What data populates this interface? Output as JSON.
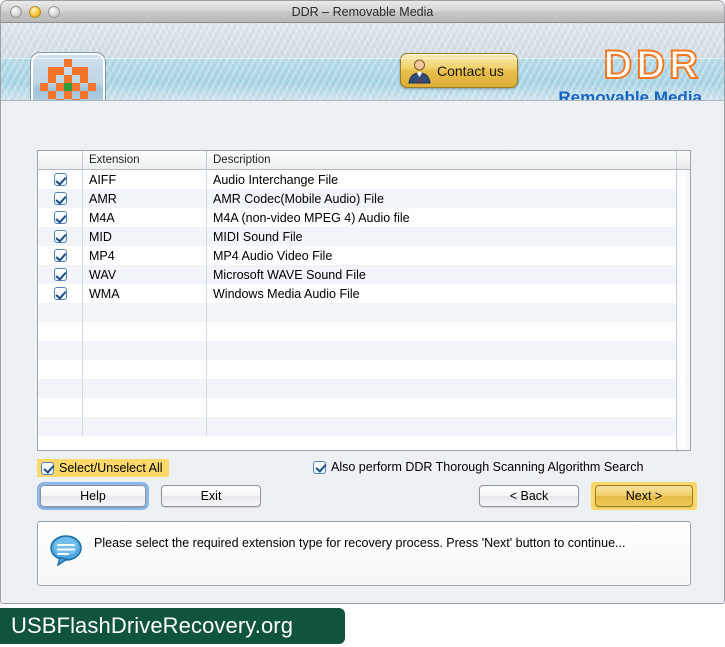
{
  "window": {
    "title": "DDR – Removable Media",
    "traffic_lights": [
      "close-button",
      "minimize-button",
      "zoom-button"
    ]
  },
  "banner": {
    "app_icon": "checkered-star-icon",
    "contact_button": {
      "label": "Contact us",
      "icon": "person-icon"
    },
    "brand": {
      "name": "DDR",
      "subtitle": "Removable Media"
    },
    "colors": {
      "brand_orange": "#f47722",
      "brand_blue": "#1765c0"
    }
  },
  "table": {
    "headers": [
      "",
      "Extension",
      "Description"
    ],
    "rows": [
      {
        "checked": true,
        "extension": "AIFF",
        "description": "Audio Interchange File"
      },
      {
        "checked": true,
        "extension": "AMR",
        "description": "AMR Codec(Mobile Audio) File"
      },
      {
        "checked": true,
        "extension": "M4A",
        "description": "M4A (non-video MPEG 4) Audio file"
      },
      {
        "checked": true,
        "extension": "MID",
        "description": "MIDI Sound File"
      },
      {
        "checked": true,
        "extension": "MP4",
        "description": "MP4 Audio Video File"
      },
      {
        "checked": true,
        "extension": "WAV",
        "description": "Microsoft WAVE Sound File"
      },
      {
        "checked": true,
        "extension": "WMA",
        "description": "Windows Media Audio File"
      }
    ],
    "empty_row_count": 7
  },
  "options": {
    "select_all": {
      "label": "Select/Unselect All",
      "checked": true,
      "highlight": "#fbd96a"
    },
    "thorough_scan": {
      "label": "Also perform DDR Thorough Scanning Algorithm Search",
      "checked": true
    }
  },
  "buttons": {
    "help": "Help",
    "exit": "Exit",
    "back": "< Back",
    "next": "Next >",
    "next_highlight": "#fbd96a"
  },
  "message": {
    "icon": "speech-bubble-icon",
    "text": "Please select the required extension type for recovery process. Press 'Next' button to continue..."
  },
  "footer": {
    "text": "USBFlashDriveRecovery.org",
    "color": "#10543f"
  }
}
